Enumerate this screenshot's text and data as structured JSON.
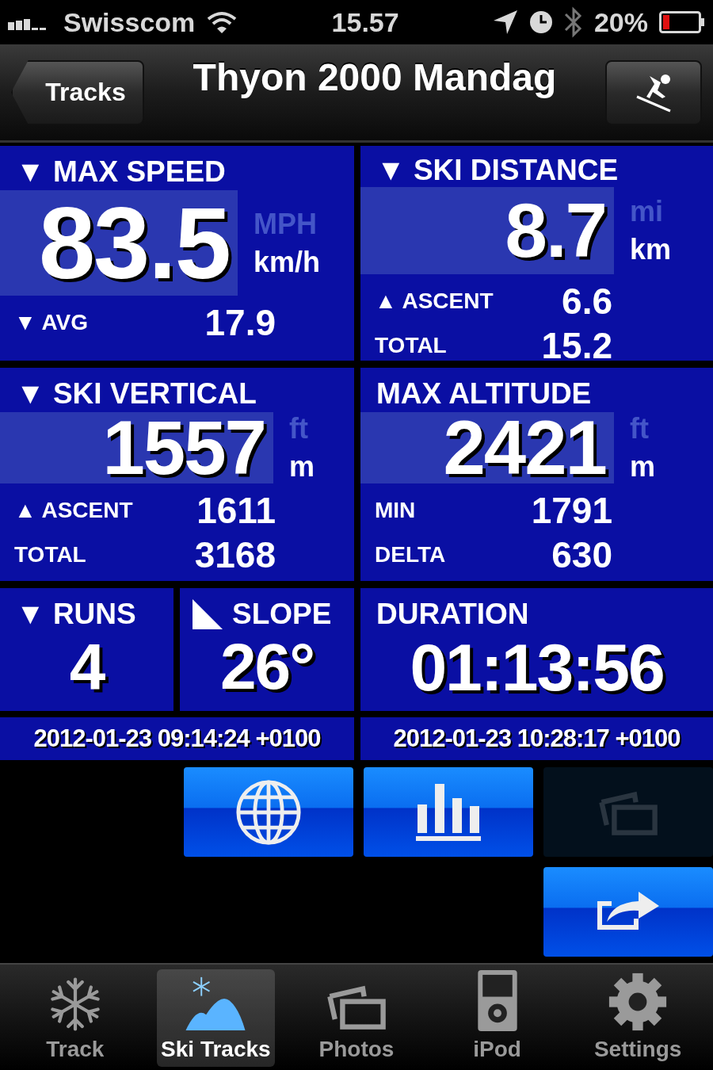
{
  "status_bar": {
    "carrier": "Swisscom",
    "time": "15.57",
    "battery": "20%"
  },
  "nav_bar": {
    "back": "Tracks",
    "title": "Thyon 2000 Mandag"
  },
  "stats": [
    {
      "kind": "metric",
      "title": "▼ MAX SPEED",
      "value": "83.5",
      "units": [
        {
          "label": "MPH",
          "selected": false
        },
        {
          "label": "km/h",
          "selected": true
        }
      ],
      "rows": [
        {
          "label": "▼ AVG",
          "value": "17.9"
        }
      ]
    },
    {
      "kind": "metric",
      "title": "▼ SKI DISTANCE",
      "value": "8.7",
      "units": [
        {
          "label": "mi",
          "selected": false
        },
        {
          "label": "km",
          "selected": true
        }
      ],
      "rows": [
        {
          "label": "▲ ASCENT",
          "value": "6.6"
        },
        {
          "label": "TOTAL",
          "value": "15.2"
        }
      ]
    },
    {
      "kind": "metric",
      "title": "▼ SKI VERTICAL",
      "value": "1557",
      "units": [
        {
          "label": "ft",
          "selected": false
        },
        {
          "label": "m",
          "selected": true
        }
      ],
      "rows": [
        {
          "label": "▲ ASCENT",
          "value": "1611"
        },
        {
          "label": "TOTAL",
          "value": "3168"
        }
      ]
    },
    {
      "kind": "metric",
      "title": "MAX ALTITUDE",
      "value": "2421",
      "units": [
        {
          "label": "ft",
          "selected": false
        },
        {
          "label": "m",
          "selected": true
        }
      ],
      "rows": [
        {
          "label": "MIN",
          "value": "1791"
        },
        {
          "label": "DELTA",
          "value": "630"
        }
      ]
    },
    {
      "kind": "counter",
      "title": "▼ RUNS",
      "value": "4"
    },
    {
      "kind": "slope",
      "title": "SLOPE",
      "value": "26°"
    },
    {
      "kind": "duration",
      "title": "DURATION",
      "value": "01:13:56"
    }
  ],
  "timestamps": [
    "2012-01-23 09:14:24 +0100",
    "2012-01-23 10:28:17 +0100"
  ],
  "actions": [
    {
      "kind": "globe",
      "disabled": false
    },
    {
      "kind": "chart",
      "disabled": false
    },
    {
      "kind": "photos",
      "disabled": true
    },
    {
      "kind": "share",
      "disabled": false
    }
  ],
  "tabs": [
    {
      "kind": "snowflake",
      "label": "Track",
      "selected": false
    },
    {
      "kind": "mountain",
      "label": "Ski Tracks",
      "selected": true
    },
    {
      "kind": "photos",
      "label": "Photos",
      "selected": false
    },
    {
      "kind": "ipod",
      "label": "iPod",
      "selected": false
    },
    {
      "kind": "gear",
      "label": "Settings",
      "selected": false
    }
  ]
}
